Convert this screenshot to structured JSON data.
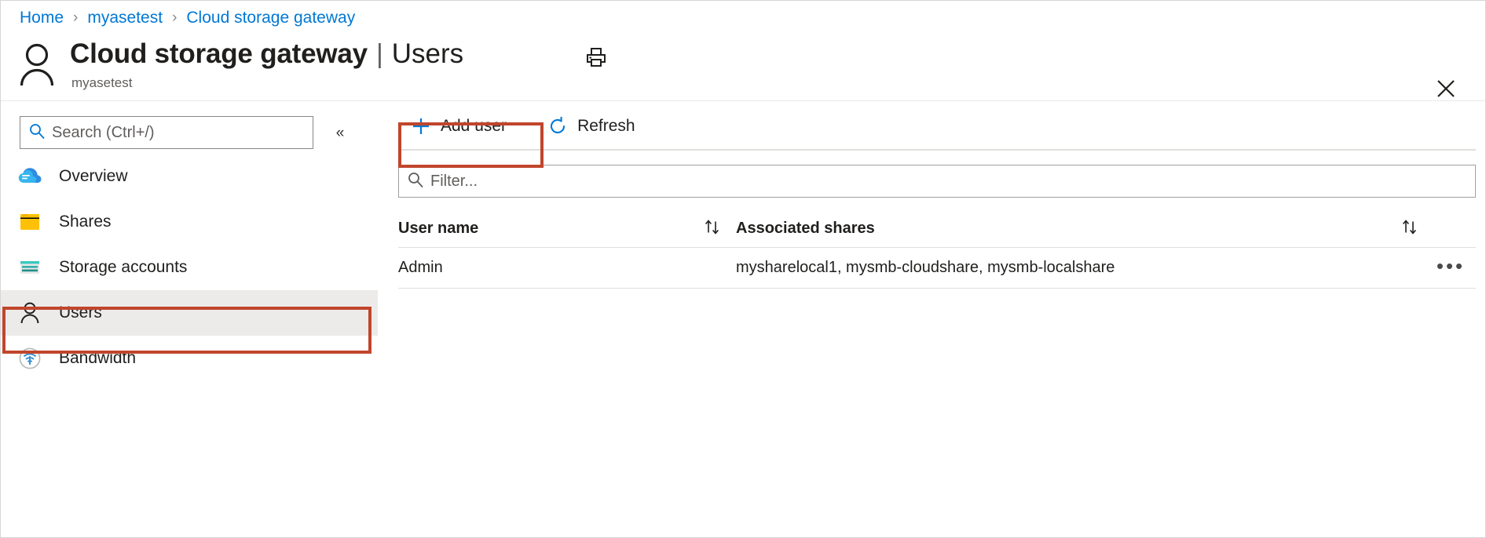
{
  "breadcrumb": {
    "separator": "›",
    "items": [
      {
        "label": "Home"
      },
      {
        "label": "myasetest"
      },
      {
        "label": "Cloud storage gateway"
      }
    ]
  },
  "header": {
    "resource_title": "Cloud storage gateway",
    "title_separator": "|",
    "section_title": "Users",
    "subtitle": "myasetest",
    "print_icon": "printer-icon",
    "close_icon": "close-icon",
    "avatar_icon": "person-icon"
  },
  "sidebar": {
    "search": {
      "placeholder": "Search (Ctrl+/)",
      "icon": "search-icon"
    },
    "collapse": {
      "label": "«",
      "icon": "chevron-double-left-icon"
    },
    "items": [
      {
        "label": "Overview",
        "icon": "cloud-icon",
        "selected": false
      },
      {
        "label": "Shares",
        "icon": "folder-icon",
        "selected": false
      },
      {
        "label": "Storage accounts",
        "icon": "storage-account-icon",
        "selected": false
      },
      {
        "label": "Users",
        "icon": "person-icon",
        "selected": true
      },
      {
        "label": "Bandwidth",
        "icon": "bandwidth-icon",
        "selected": false
      }
    ]
  },
  "toolbar": {
    "add_user_label": "Add user",
    "add_user_icon": "plus-icon",
    "refresh_label": "Refresh",
    "refresh_icon": "refresh-icon"
  },
  "filter": {
    "placeholder": "Filter...",
    "icon": "search-icon"
  },
  "table": {
    "columns": [
      {
        "label": "User name",
        "sort_icon": "sort-arrows-icon"
      },
      {
        "label": "Associated shares",
        "sort_icon": "sort-arrows-icon"
      }
    ],
    "rows": [
      {
        "user_name": "Admin",
        "associated_shares": "mysharelocal1, mysmb-cloudshare, mysmb-localshare",
        "menu_label": "•••"
      }
    ]
  },
  "highlights": {
    "accent_color": "#c0462c",
    "boxes": [
      {
        "target": "add-user-button"
      },
      {
        "target": "sidebar-item-users"
      }
    ]
  },
  "colors": {
    "link": "#0078d4",
    "accent_blue": "#0078d4",
    "selected_bg": "#edebe9",
    "highlight_red": "#c0462c",
    "text_primary": "#201f1e",
    "text_secondary": "#605e5c"
  }
}
